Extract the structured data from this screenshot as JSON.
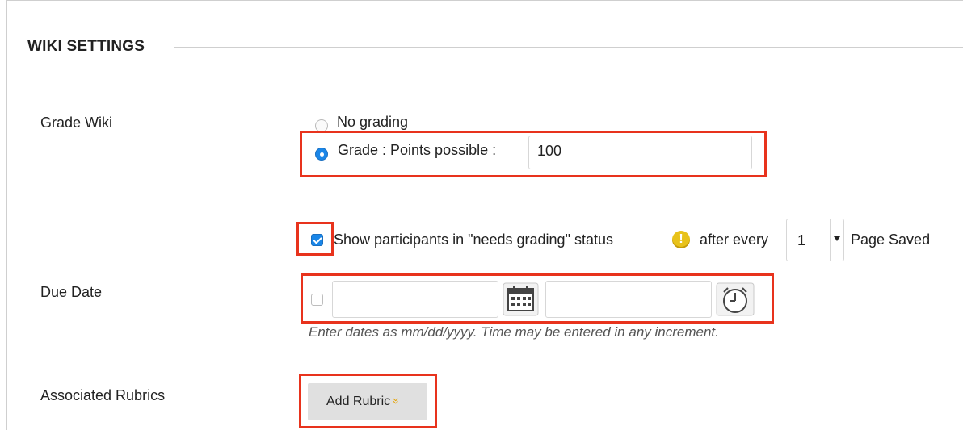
{
  "section": {
    "title": "WIKI SETTINGS"
  },
  "grade": {
    "label": "Grade Wiki",
    "no_grading_label": "No grading",
    "grade_label": "Grade : Points possible :",
    "points_value": "100",
    "selected": "grade"
  },
  "needs_grading": {
    "checked": true,
    "text_before": "Show participants in \"needs grading\" status",
    "text_after": "after every",
    "count_value": "1",
    "text_end": "Page Saved"
  },
  "due_date": {
    "label": "Due Date",
    "enabled": false,
    "date_value": "",
    "time_value": "",
    "hint": "Enter dates as mm/dd/yyyy. Time may be entered in any increment."
  },
  "rubrics": {
    "label": "Associated Rubrics",
    "add_button": "Add Rubric"
  },
  "colors": {
    "highlight": "#e8331d",
    "accent": "#1a86e8",
    "warning": "#e8c21a"
  },
  "icons": [
    "radio-off-icon",
    "radio-on-icon",
    "checkbox-icon",
    "warning-icon",
    "calendar-icon",
    "clock-icon",
    "chevron-double-down-icon"
  ]
}
